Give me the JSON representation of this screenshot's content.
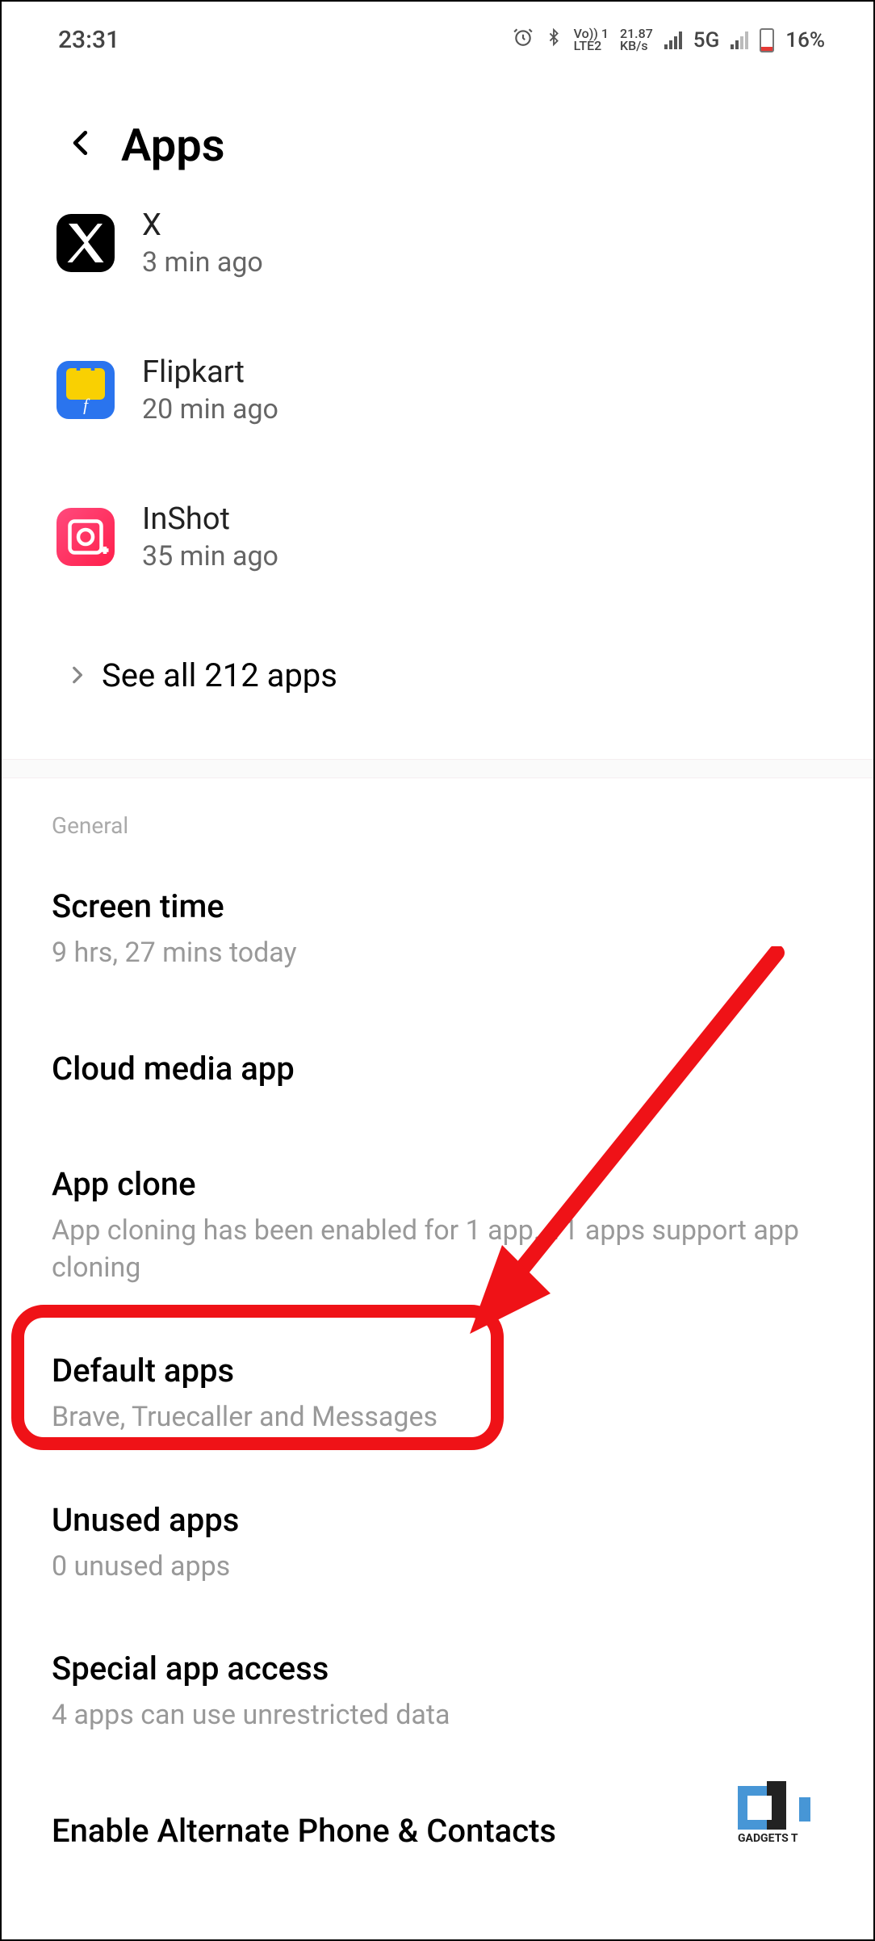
{
  "statusBar": {
    "time": "23:31",
    "volte1": "Vo)) 1",
    "lte2": "LTE2",
    "speedVal": "21.87",
    "speedUnit": "KB/s",
    "network": "5G",
    "battery": "16%"
  },
  "header": {
    "title": "Apps"
  },
  "apps": [
    {
      "name": "X",
      "sub": "3 min ago"
    },
    {
      "name": "Flipkart",
      "sub": "20 min ago"
    },
    {
      "name": "InShot",
      "sub": "35 min ago"
    }
  ],
  "seeAll": "See all 212 apps",
  "sectionLabel": "General",
  "settings": {
    "screenTime": {
      "title": "Screen time",
      "sub": "9 hrs, 27 mins today"
    },
    "cloudMedia": {
      "title": "Cloud media app"
    },
    "appClone": {
      "title": "App clone",
      "sub": "App cloning has been enabled for 1 app. 11 apps support app cloning"
    },
    "defaultApps": {
      "title": "Default apps",
      "sub": "Brave, Truecaller and Messages"
    },
    "unusedApps": {
      "title": "Unused apps",
      "sub": "0 unused apps"
    },
    "specialAccess": {
      "title": "Special app access",
      "sub": "4 apps can use unrestricted data"
    },
    "altPhone": {
      "title": "Enable Alternate Phone & Contacts"
    }
  },
  "watermark": "GADGETS T"
}
